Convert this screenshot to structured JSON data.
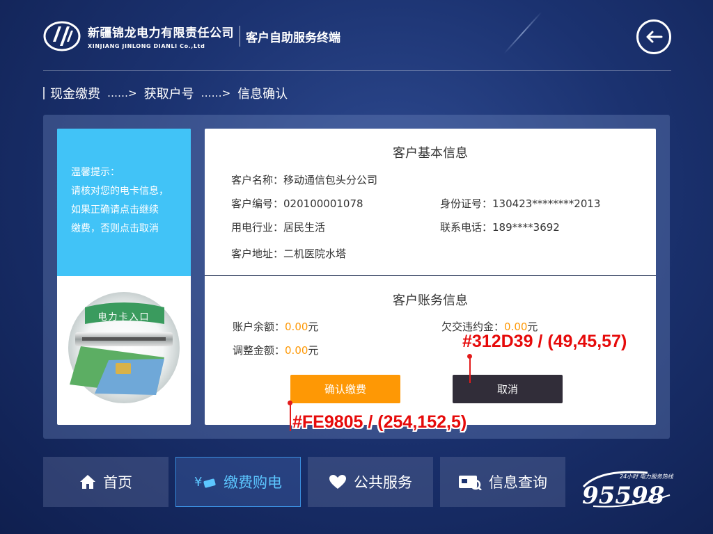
{
  "header": {
    "company_cn": "新疆锦龙电力有限责任公司",
    "company_en": "XINJIANG JINLONG DIANLI Co.,Ltd",
    "terminal_title": "客户自助服务终端"
  },
  "breadcrumb": {
    "steps": [
      "现金缴费",
      "获取户号",
      "信息确认"
    ],
    "separator": "……>"
  },
  "tip": {
    "lines": [
      "温馨提示：",
      "请核对您的电卡信息，",
      "如果正确请点击继续",
      "缴费，否则点击取消"
    ],
    "image_label": "电力卡入口"
  },
  "basic_info": {
    "title": "客户基本信息",
    "name_label": "客户名称：",
    "name_value": "移动通信包头分公司",
    "number_label": "客户编号：",
    "number_value": "020100001078",
    "id_label": "身份证号：",
    "id_value": "130423********2013",
    "industry_label": "用电行业：",
    "industry_value": "居民生活",
    "phone_label": "联系电话：",
    "phone_value": "189****3692",
    "address_label": "客户地址：",
    "address_value": "二机医院水塔"
  },
  "account_info": {
    "title": "客户账务信息",
    "balance_label": "账户余额：",
    "balance_value": "0.00",
    "balance_unit": "元",
    "penalty_label": "欠交违约金：",
    "penalty_value": "0.00",
    "penalty_unit": "元",
    "adjust_label": "调整金额：",
    "adjust_value": "0.00",
    "adjust_unit": "元"
  },
  "buttons": {
    "confirm": "确认缴费",
    "cancel": "取消"
  },
  "annotations": {
    "cancel_color": "#312D39 / (49,45,57)",
    "confirm_color": "#FE9805 / (254,152,5)"
  },
  "nav": {
    "home": "首页",
    "pay": "缴费购电",
    "public": "公共服务",
    "query": "信息查询"
  },
  "hotline": {
    "number": "95598",
    "slogan": "24小时 电力服务热线"
  },
  "colors": {
    "accent_orange": "#FE9805",
    "cancel_dark": "#312D39",
    "tip_blue": "#41C3F7",
    "active_nav": "#5CC6FF"
  }
}
